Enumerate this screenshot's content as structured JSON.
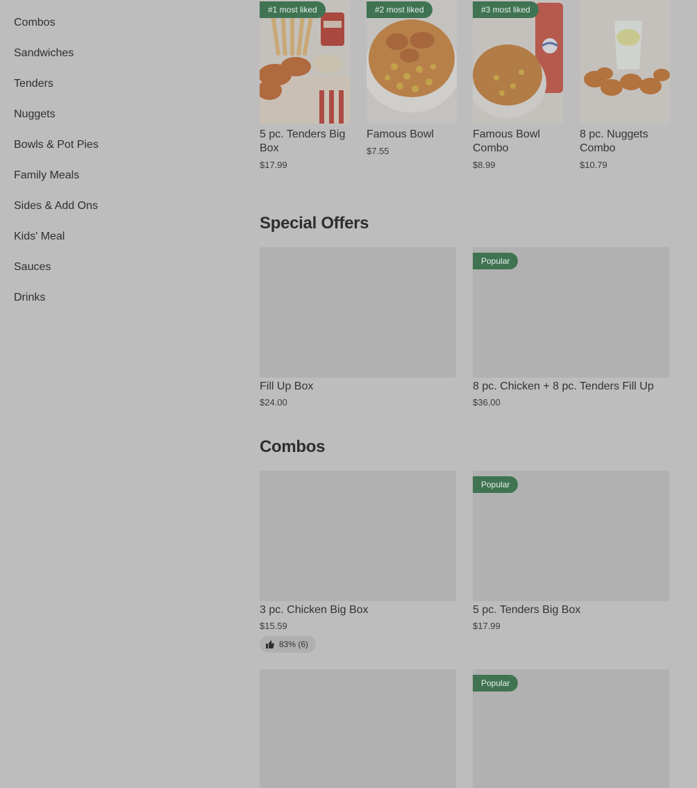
{
  "sidebar": {
    "items": [
      {
        "label": "Combos"
      },
      {
        "label": "Sandwiches"
      },
      {
        "label": "Tenders"
      },
      {
        "label": "Nuggets"
      },
      {
        "label": "Bowls & Pot Pies"
      },
      {
        "label": "Family Meals"
      },
      {
        "label": "Sides & Add Ons"
      },
      {
        "label": "Kids' Meal"
      },
      {
        "label": "Sauces"
      },
      {
        "label": "Drinks"
      }
    ]
  },
  "most_liked": [
    {
      "badge": "#1 most liked",
      "name": "5 pc. Tenders Big Box",
      "price": "$17.99"
    },
    {
      "badge": "#2 most liked",
      "name": "Famous Bowl",
      "price": "$7.55"
    },
    {
      "badge": "#3 most liked",
      "name": "Famous Bowl Combo",
      "price": "$8.99"
    },
    {
      "badge": "",
      "name": "8 pc. Nuggets Combo",
      "price": "$10.79"
    }
  ],
  "special_offers": {
    "title": "Special Offers",
    "items": [
      {
        "badge": "",
        "name": "Fill Up Box",
        "price": "$24.00"
      },
      {
        "badge": "Popular",
        "name": "8 pc. Chicken + 8 pc. Tenders Fill Up",
        "price": "$36.00"
      }
    ]
  },
  "combos": {
    "title": "Combos",
    "items": [
      {
        "badge": "",
        "name": "3 pc. Chicken Big Box",
        "price": "$15.59",
        "rating": "83% (6)"
      },
      {
        "badge": "Popular",
        "name": "5 pc. Tenders Big Box",
        "price": "$17.99"
      },
      {
        "badge": ""
      },
      {
        "badge": "Popular"
      }
    ]
  },
  "colors": {
    "overlay_bg": "#bdbdbd",
    "badge_bg": "#3f7352",
    "placeholder": "#b1b1b1"
  }
}
